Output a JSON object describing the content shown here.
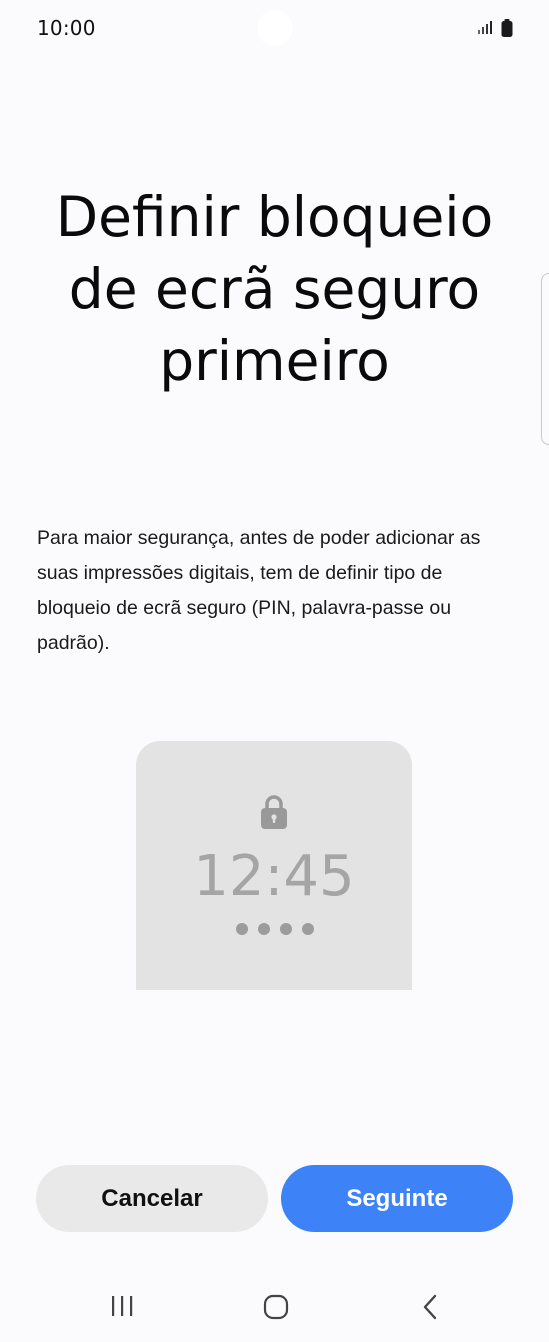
{
  "status_bar": {
    "time": "10:00",
    "signal_icon": "signal-bars-icon",
    "battery_icon": "battery-icon"
  },
  "page": {
    "title": "Definir bloqueio de ecrã seguro primeiro",
    "description": "Para maior segurança, antes de poder adicionar as suas impressões digitais, tem de definir tipo de bloqueio de ecrã seguro (PIN, palavra-passe ou padrão)."
  },
  "lockscreen_preview": {
    "lock_icon": "padlock-icon",
    "clock": "12:45",
    "pin_dot_count": 4
  },
  "buttons": {
    "cancel_label": "Cancelar",
    "next_label": "Seguinte"
  },
  "navigation": {
    "recents_icon": "recents-icon",
    "home_icon": "home-icon",
    "back_icon": "back-icon"
  },
  "colors": {
    "background": "#fbfbfd",
    "primary_button": "#3e82f7",
    "secondary_button": "#e9e9e9",
    "preview_background": "#e3e3e3"
  }
}
